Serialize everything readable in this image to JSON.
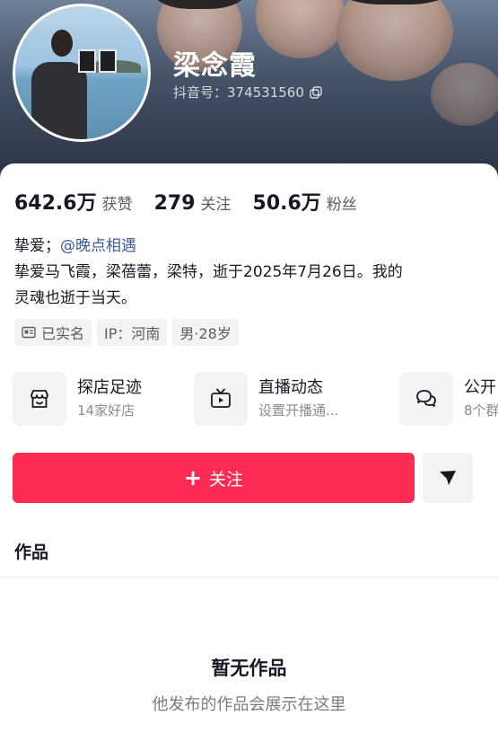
{
  "profile": {
    "name": "梁念霞",
    "douyin_id": "抖音号：374531560"
  },
  "stats": [
    {
      "value": "642.6万",
      "label": "获赞"
    },
    {
      "value": "279",
      "label": "关注"
    },
    {
      "value": "50.6万",
      "label": "粉丝"
    }
  ],
  "bio": {
    "prefix": "挚爱；",
    "mention": "@晚点相遇",
    "line2": "挚爱马飞霞，梁蓓蕾，梁特，逝于2025年7月26日。我的",
    "line3": "灵魂也逝于当天。"
  },
  "tags": [
    {
      "icon": "id-card-icon",
      "label": "已实名"
    },
    {
      "icon": "",
      "label": "IP：河南"
    },
    {
      "icon": "",
      "label": "男·28岁"
    }
  ],
  "shortcuts": [
    {
      "icon": "store-icon",
      "title": "探店足迹",
      "subtitle": "14家好店"
    },
    {
      "icon": "tv-icon",
      "title": "直播动态",
      "subtitle": "设置开播通..."
    },
    {
      "icon": "chat-icon",
      "title": "公开",
      "subtitle": "8个群"
    }
  ],
  "actions": {
    "follow_label": "关注",
    "share_icon": "send-icon"
  },
  "works": {
    "title": "作品",
    "empty_title": "暂无作品",
    "empty_subtitle": "他发布的作品会展示在这里"
  },
  "colors": {
    "accent": "#fe2c55",
    "mention": "#3b5a9a"
  }
}
